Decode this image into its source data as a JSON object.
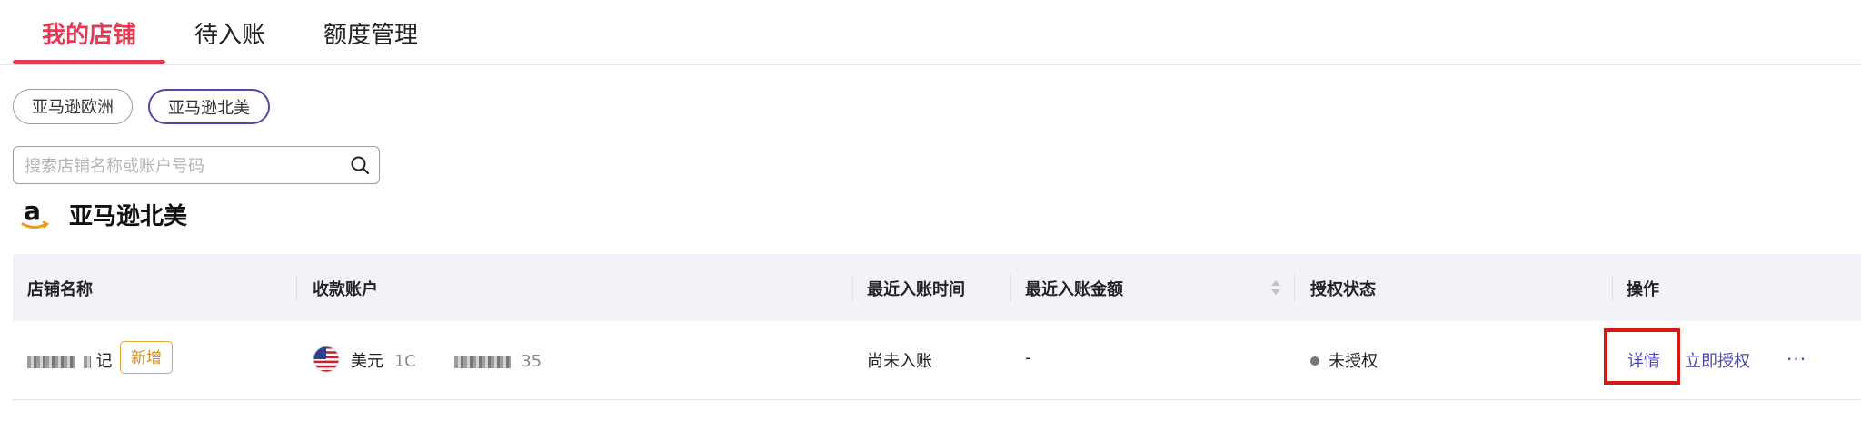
{
  "tabs": [
    {
      "label": "我的店铺",
      "active": true
    },
    {
      "label": "待入账",
      "active": false
    },
    {
      "label": "额度管理",
      "active": false
    }
  ],
  "region_chips": [
    {
      "label": "亚马逊欧洲",
      "active": false
    },
    {
      "label": "亚马逊北美",
      "active": true
    }
  ],
  "search": {
    "placeholder": "搜索店铺名称或账户号码",
    "value": ""
  },
  "section": {
    "title": "亚马逊北美",
    "logo_icon": "amazon-logo"
  },
  "table": {
    "columns": [
      "店铺名称",
      "收款账户",
      "最近入账时间",
      "最近入账金额",
      "授权状态",
      "操作"
    ],
    "rows": [
      {
        "store_name_suffix": "记",
        "badge": "新增",
        "currency": "美元",
        "account_prefix": "1C",
        "account_suffix": "35",
        "flag_icon": "us-flag",
        "last_time": "尚未入账",
        "last_amount": "-",
        "auth_status": "未授权",
        "actions": {
          "detail": "详情",
          "authorize": "立即授权",
          "more": "···"
        }
      }
    ]
  },
  "colors": {
    "accent": "#e33b55",
    "link": "#4b4aa8",
    "badge": "#e3a53a",
    "highlight": "#d21b12"
  }
}
